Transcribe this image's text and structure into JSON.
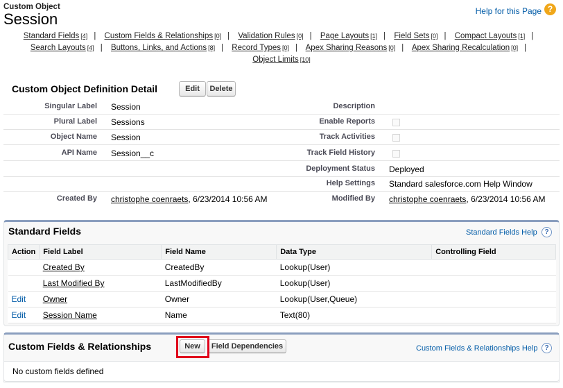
{
  "header": {
    "object_type": "Custom Object",
    "title": "Session",
    "help_link": "Help for this Page"
  },
  "related_nav": {
    "rows": [
      [
        {
          "label": "Standard Fields",
          "count": "[4]"
        },
        {
          "label": "Custom Fields & Relationships",
          "count": "[0]"
        },
        {
          "label": "Validation Rules",
          "count": "[0]"
        },
        {
          "label": "Page Layouts",
          "count": "[1]"
        },
        {
          "label": "Field Sets",
          "count": "[0]"
        },
        {
          "label": "Compact Layouts",
          "count": "[1]"
        }
      ],
      [
        {
          "label": "Search Layouts",
          "count": "[4]"
        },
        {
          "label": "Buttons, Links, and Actions",
          "count": "[8]"
        },
        {
          "label": "Record Types",
          "count": "[0]"
        },
        {
          "label": "Apex Sharing Reasons",
          "count": "[0]"
        },
        {
          "label": "Apex Sharing Recalculation",
          "count": "[0]"
        }
      ],
      [
        {
          "label": "Object Limits",
          "count": "[10]"
        }
      ]
    ]
  },
  "detail": {
    "title": "Custom Object Definition Detail",
    "edit_label": "Edit",
    "delete_label": "Delete",
    "left": [
      {
        "label": "Singular Label",
        "value": "Session"
      },
      {
        "label": "Plural Label",
        "value": "Sessions"
      },
      {
        "label": "Object Name",
        "value": "Session"
      },
      {
        "label": "API Name",
        "value": "Session__c"
      }
    ],
    "right": [
      {
        "label": "Description",
        "value": ""
      },
      {
        "label": "Enable Reports",
        "value": ""
      },
      {
        "label": "Track Activities",
        "value": ""
      },
      {
        "label": "Track Field History",
        "value": ""
      },
      {
        "label": "Deployment Status",
        "value": "Deployed"
      },
      {
        "label": "Help Settings",
        "value": "Standard salesforce.com Help Window"
      }
    ],
    "created_by_label": "Created By",
    "created_by_user": "christophe coenraets",
    "created_by_date": ", 6/23/2014 10:56 AM",
    "modified_by_label": "Modified By",
    "modified_by_user": "christophe coenraets",
    "modified_by_date": ", 6/23/2014 10:56 AM"
  },
  "standard_fields": {
    "title": "Standard Fields",
    "help": "Standard Fields Help",
    "columns": [
      "Action",
      "Field Label",
      "Field Name",
      "Data Type",
      "Controlling Field"
    ],
    "rows": [
      {
        "action": "",
        "label": "Created By",
        "name": "CreatedBy",
        "type": "Lookup(User)",
        "controlling": ""
      },
      {
        "action": "",
        "label": "Last Modified By",
        "name": "LastModifiedBy",
        "type": "Lookup(User)",
        "controlling": ""
      },
      {
        "action": "Edit",
        "label": "Owner",
        "name": "Owner",
        "type": "Lookup(User,Queue)",
        "controlling": ""
      },
      {
        "action": "Edit",
        "label": "Session Name",
        "name": "Name",
        "type": "Text(80)",
        "controlling": ""
      }
    ]
  },
  "custom_fields": {
    "title": "Custom Fields & Relationships",
    "new_label": "New",
    "dependencies_label": "Field Dependencies",
    "help": "Custom Fields & Relationships Help",
    "empty_text": "No custom fields defined"
  }
}
